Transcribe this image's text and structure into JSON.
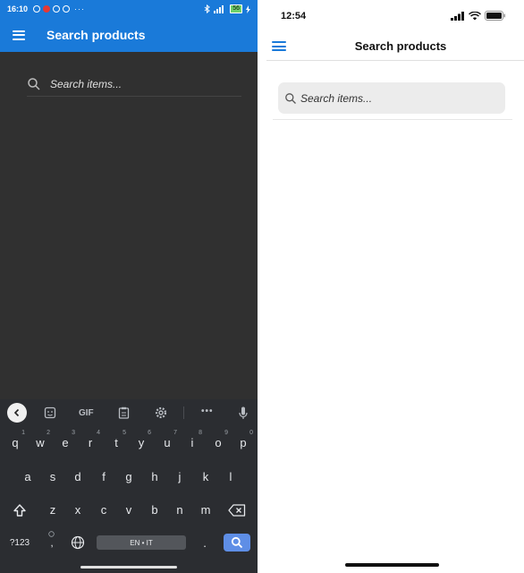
{
  "android": {
    "status": {
      "time": "16:10",
      "battery": "56"
    },
    "appbar": {
      "title": "Search products"
    },
    "search": {
      "placeholder": "Search items..."
    },
    "keyboard": {
      "toolbar": {
        "gif": "GIF",
        "more": "•••"
      },
      "row1": [
        {
          "k": "q",
          "s": "1"
        },
        {
          "k": "w",
          "s": "2"
        },
        {
          "k": "e",
          "s": "3"
        },
        {
          "k": "r",
          "s": "4"
        },
        {
          "k": "t",
          "s": "5"
        },
        {
          "k": "y",
          "s": "6"
        },
        {
          "k": "u",
          "s": "7"
        },
        {
          "k": "i",
          "s": "8"
        },
        {
          "k": "o",
          "s": "9"
        },
        {
          "k": "p",
          "s": "0"
        }
      ],
      "row2": [
        "a",
        "s",
        "d",
        "f",
        "g",
        "h",
        "j",
        "k",
        "l"
      ],
      "row3": [
        "z",
        "x",
        "c",
        "v",
        "b",
        "n",
        "m"
      ],
      "symbols": "?123",
      "comma": ",",
      "space": "EN • IT",
      "period": "."
    }
  },
  "ios": {
    "status": {
      "time": "12:54"
    },
    "nav": {
      "title": "Search products"
    },
    "search": {
      "placeholder": "Search items..."
    }
  }
}
